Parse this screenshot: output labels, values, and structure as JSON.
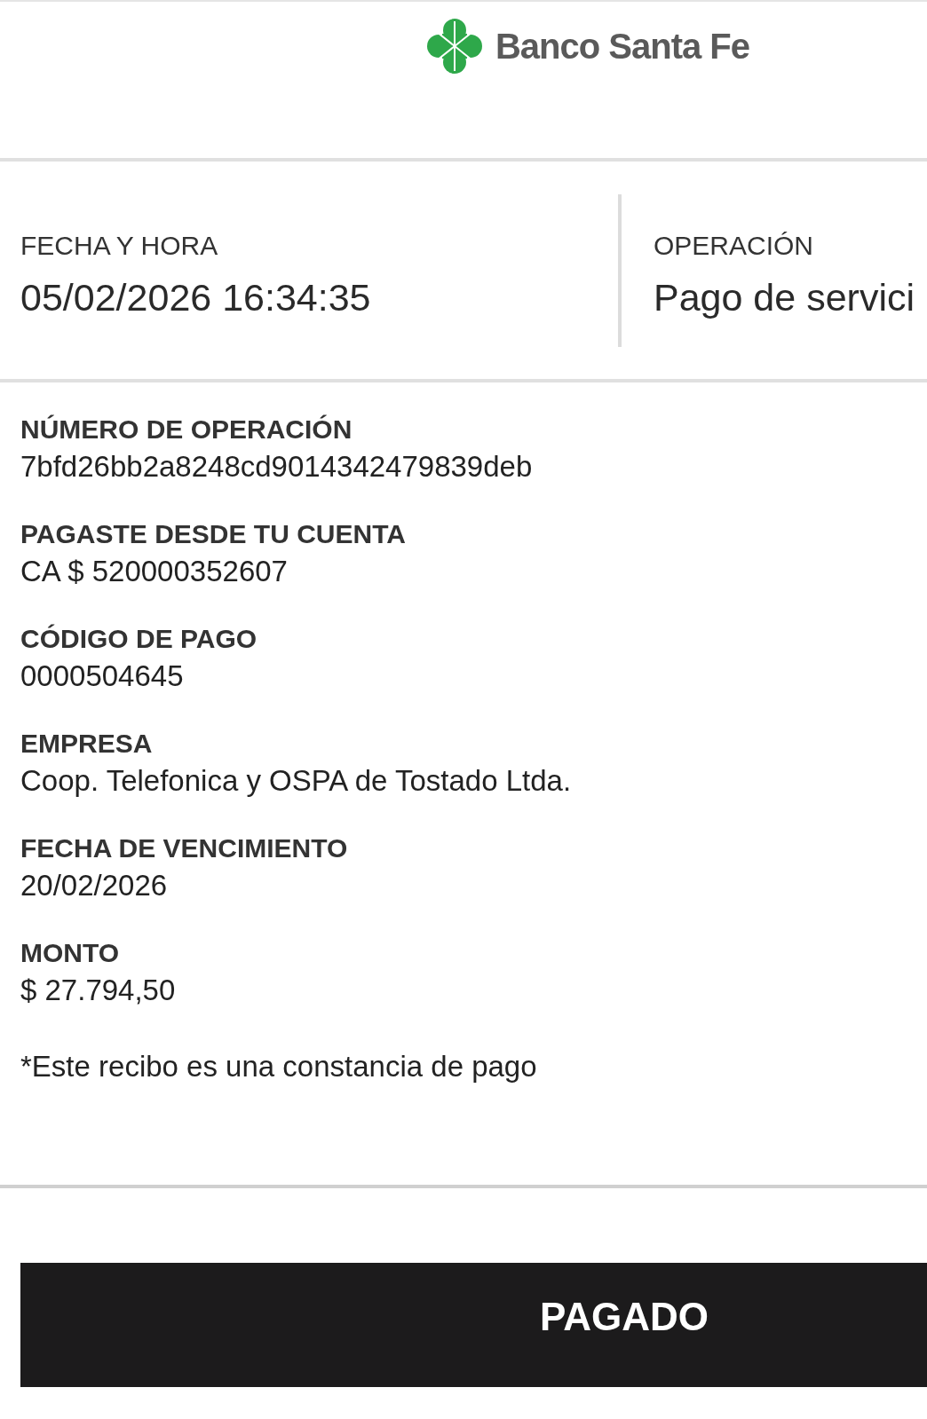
{
  "logo": {
    "text": "Banco Santa Fe"
  },
  "summary": [
    {
      "label": "FECHA Y HORA",
      "value": "05/02/2026 16:34:35"
    },
    {
      "label": "OPERACIÓN",
      "value": "Pago de servici"
    }
  ],
  "fields": [
    {
      "label": "NÚMERO DE OPERACIÓN",
      "value": "7bfd26bb2a8248cd9014342479839deb"
    },
    {
      "label": "PAGASTE DESDE TU CUENTA",
      "value": "CA $ 520000352607"
    },
    {
      "label": "CÓDIGO DE PAGO",
      "value": "0000504645"
    },
    {
      "label": "EMPRESA",
      "value": "Coop. Telefonica y OSPA de Tostado Ltda."
    },
    {
      "label": "FECHA DE VENCIMIENTO",
      "value": "20/02/2026"
    },
    {
      "label": "MONTO",
      "value": "$ 27.794,50"
    }
  ],
  "note": "*Este recibo es una constancia de pago",
  "status": "PAGADO"
}
